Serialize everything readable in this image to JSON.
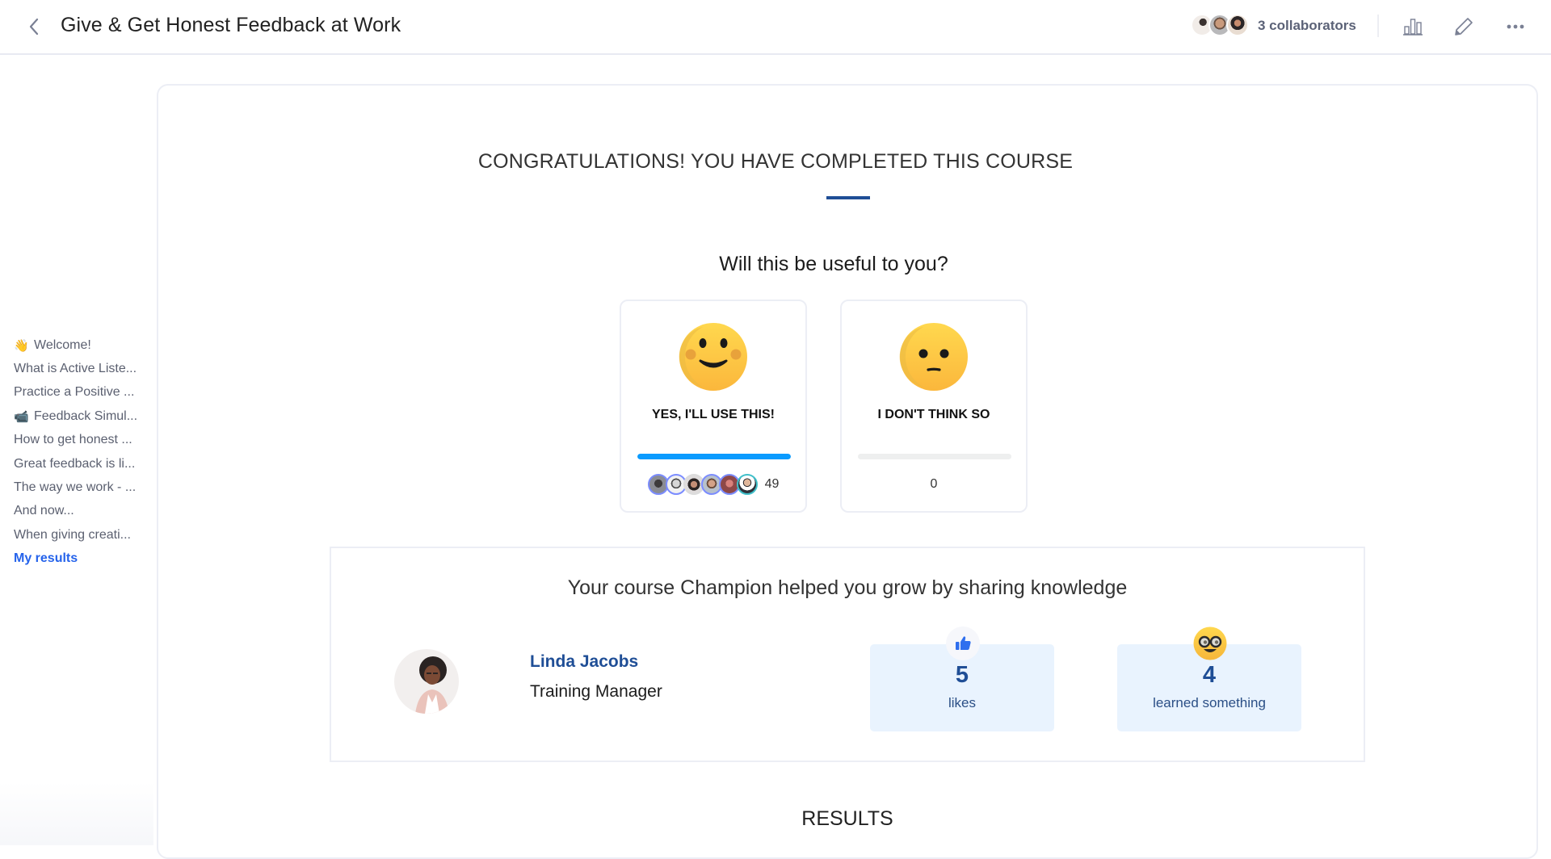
{
  "header": {
    "title": "Give & Get Honest Feedback at Work",
    "collaborators_label": "3 collaborators",
    "collaborator_count": 3,
    "icons": {
      "back": "chevron-left-icon",
      "analytics": "bar-chart-icon",
      "edit": "pencil-icon",
      "more": "more-horizontal-icon"
    }
  },
  "sidebar": {
    "items": [
      {
        "emoji": "👋",
        "label": "Welcome!",
        "active": false
      },
      {
        "emoji": "",
        "label": "What is Active Liste...",
        "active": false
      },
      {
        "emoji": "",
        "label": "Practice a Positive ...",
        "active": false
      },
      {
        "emoji": "📹",
        "label": "Feedback Simul...",
        "active": false
      },
      {
        "emoji": "",
        "label": "How to get honest ...",
        "active": false
      },
      {
        "emoji": "",
        "label": "Great feedback is li...",
        "active": false
      },
      {
        "emoji": "",
        "label": "The way we work - ...",
        "active": false
      },
      {
        "emoji": "",
        "label": "And now...",
        "active": false
      },
      {
        "emoji": "",
        "label": "When giving creati...",
        "active": false
      },
      {
        "emoji": "",
        "label": "My results",
        "active": true
      }
    ]
  },
  "completion": {
    "heading": "CONGRATULATIONS! YOU HAVE COMPLETED THIS COURSE",
    "question": "Will this be useful to you?",
    "options": [
      {
        "label": "YES, I'LL USE THIS!",
        "face": "smiling-face-icon",
        "votes": 49,
        "share_percent": 100,
        "voter_avatars_shown": 6
      },
      {
        "label": "I DON'T THINK SO",
        "face": "confused-face-icon",
        "votes": 0,
        "share_percent": 0,
        "voter_avatars_shown": 0
      }
    ]
  },
  "champion": {
    "heading": "Your course Champion helped you grow by sharing knowledge",
    "name": "Linda Jacobs",
    "role": "Training Manager",
    "stats": [
      {
        "icon": "thumbs-up-icon",
        "value": "5",
        "label": "likes"
      },
      {
        "icon": "nerd-face-icon",
        "value": "4",
        "label": "learned something"
      }
    ]
  },
  "results": {
    "heading": "RESULTS"
  },
  "colors": {
    "accent_blue": "#1f4e96",
    "link_blue": "#2563eb",
    "progress_blue": "#0a9bff",
    "stat_bg": "#e9f3fe"
  }
}
